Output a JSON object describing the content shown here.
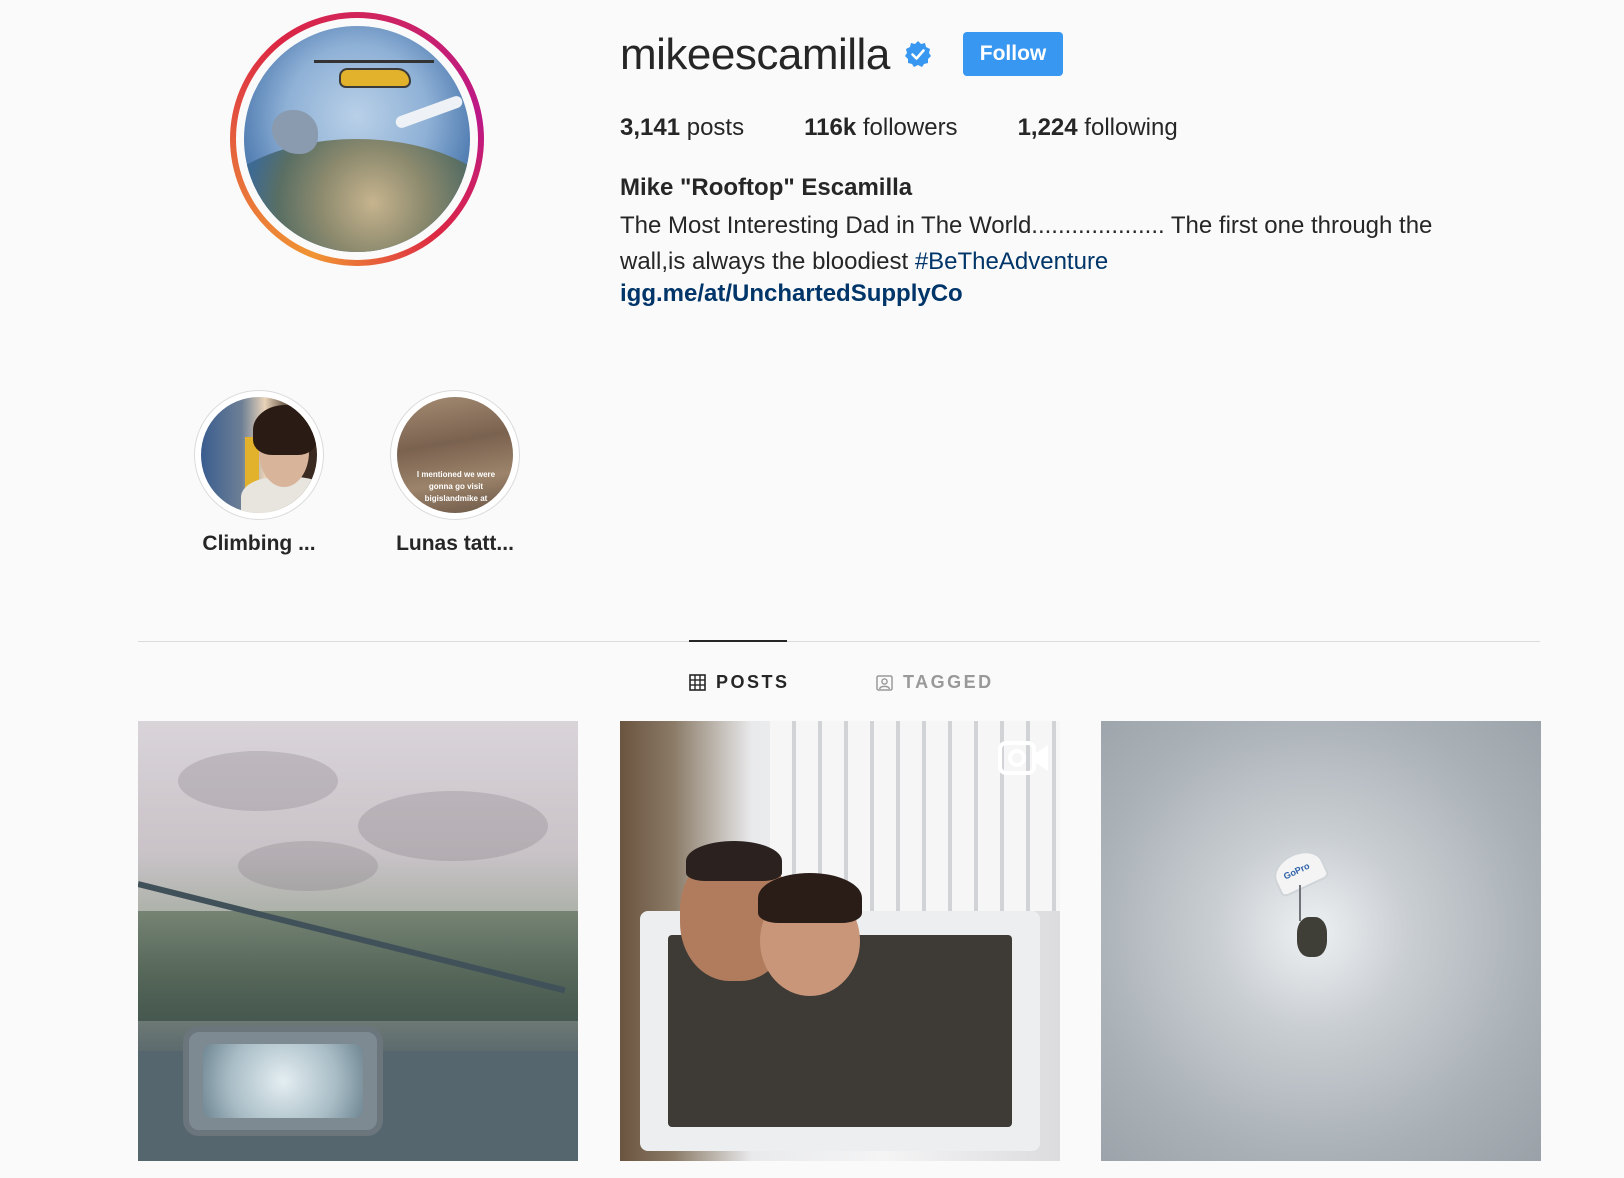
{
  "profile": {
    "username": "mikeescamilla",
    "verified": true,
    "follow_label": "Follow",
    "stats": {
      "posts_count": "3,141",
      "posts_label": "posts",
      "followers_count": "116k",
      "followers_label": "followers",
      "following_count": "1,224",
      "following_label": "following"
    },
    "full_name": "Mike \"Rooftop\" Escamilla",
    "bio_text": "The Most Interesting Dad in The World.................... The first one through the wall,is always the bloodiest ",
    "bio_hashtag": "#BeTheAdventure",
    "website": "igg.me/at/UnchartedSupplyCo"
  },
  "highlights": [
    {
      "label": "Climbing ..."
    },
    {
      "label": "Lunas tatt...",
      "caption": "I mentioned we were gonna go visit bigislandmike at"
    }
  ],
  "tabs": [
    {
      "label": "POSTS",
      "icon": "grid-icon",
      "active": true
    },
    {
      "label": "TAGGED",
      "icon": "tag-person-icon",
      "active": false
    }
  ],
  "posts": [
    {
      "type": "image",
      "subject": "hot tub on deck"
    },
    {
      "type": "video",
      "subject": "ice bath in chest freezer"
    },
    {
      "type": "image",
      "subject": "skydiver with GoPro parachute",
      "chute_text": "GoPro"
    }
  ],
  "colors": {
    "accent": "#3897f0",
    "link": "#003569",
    "background": "#fafafa",
    "text": "#262626",
    "muted": "#999999"
  }
}
